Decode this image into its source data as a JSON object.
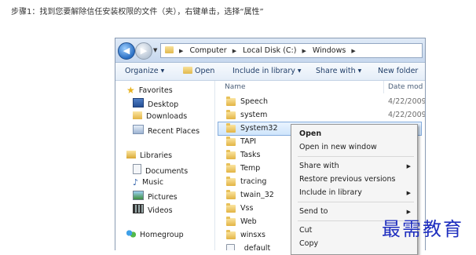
{
  "caption": "步骤1：找到您要解除信任安装权限的文件（夹），右键单击，选择“属性”",
  "address": {
    "segments": [
      "Computer",
      "Local Disk (C:)",
      "Windows"
    ]
  },
  "toolbar": {
    "organize": "Organize",
    "open": "Open",
    "include": "Include in library",
    "share": "Share with",
    "new_folder": "New folder"
  },
  "nav": {
    "favorites": "Favorites",
    "desktop": "Desktop",
    "downloads": "Downloads",
    "recent": "Recent Places",
    "libraries": "Libraries",
    "documents": "Documents",
    "music": "Music",
    "pictures": "Pictures",
    "videos": "Videos",
    "homegroup": "Homegroup"
  },
  "columns": {
    "name": "Name",
    "date": "Date mod"
  },
  "rows": [
    {
      "name": "Speech",
      "date": "4/22/2009"
    },
    {
      "name": "system",
      "date": "4/22/2009"
    },
    {
      "name": "System32",
      "date": ""
    },
    {
      "name": "TAPI",
      "date": ""
    },
    {
      "name": "Tasks",
      "date": ""
    },
    {
      "name": "Temp",
      "date": ""
    },
    {
      "name": "tracing",
      "date": ""
    },
    {
      "name": "twain_32",
      "date": ""
    },
    {
      "name": "Vss",
      "date": ""
    },
    {
      "name": "Web",
      "date": ""
    },
    {
      "name": "winsxs",
      "date": ""
    },
    {
      "name": "_default",
      "date": ""
    }
  ],
  "context_menu": {
    "open": "Open",
    "open_new": "Open in new window",
    "share": "Share with",
    "restore": "Restore previous versions",
    "include": "Include in library",
    "send": "Send to",
    "cut": "Cut",
    "copy": "Copy"
  },
  "watermark": "最需教育",
  "colors": {
    "selection": "#cfe5fc",
    "accent": "#1f3d68",
    "watermark": "#1f2fbf"
  }
}
